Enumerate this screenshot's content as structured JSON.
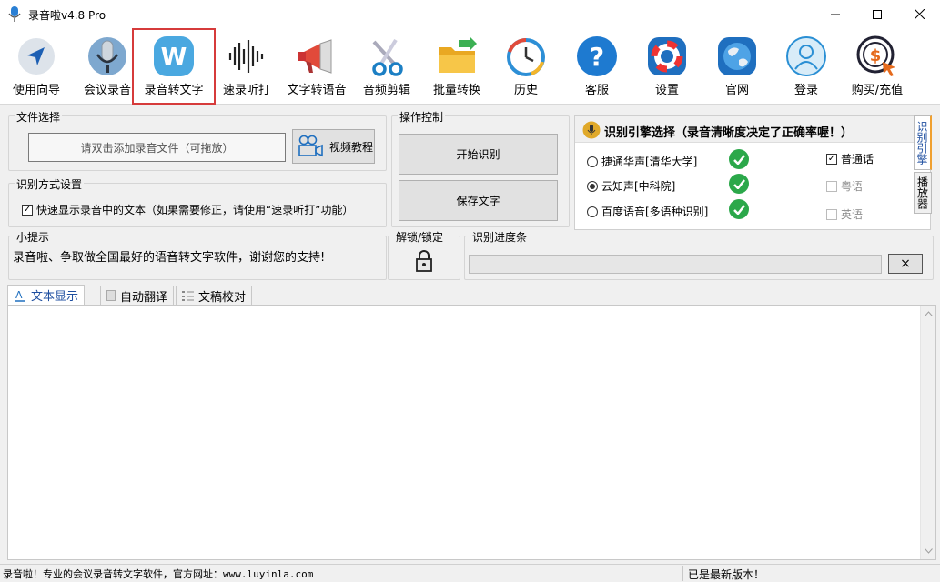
{
  "app": {
    "title": "录音啦v4.8 Pro"
  },
  "toolbar": {
    "items": [
      {
        "label": "使用向导",
        "icon": "cursor-arrow-icon"
      },
      {
        "label": "会议录音",
        "icon": "microphone-icon"
      },
      {
        "label": "录音转文字",
        "icon": "w-logo-icon"
      },
      {
        "label": "速录听打",
        "icon": "soundwave-icon"
      },
      {
        "label": "文字转语音",
        "icon": "megaphone-icon"
      },
      {
        "label": "音频剪辑",
        "icon": "scissors-icon"
      },
      {
        "label": "批量转换",
        "icon": "folder-icon"
      },
      {
        "label": "历史",
        "icon": "history-clock-icon"
      },
      {
        "label": "客服",
        "icon": "help-icon"
      },
      {
        "label": "设置",
        "icon": "lifebuoy-icon"
      },
      {
        "label": "官网",
        "icon": "globe-icon"
      },
      {
        "label": "登录",
        "icon": "user-icon"
      },
      {
        "label": "购买/充值",
        "icon": "dollar-cursor-icon"
      }
    ],
    "selected": "录音转文字"
  },
  "file_select": {
    "title": "文件选择",
    "add_button": "请双击添加录音文件（可拖放）",
    "video_button": "视频教程"
  },
  "recognize_mode": {
    "title": "识别方式设置",
    "option": "快速显示录音中的文本（如果需要修正，请使用“速录听打”功能）",
    "checked": true
  },
  "tip": {
    "title": "小提示",
    "text": "录音啦、争取做全国最好的语音转文字软件，谢谢您的支持!"
  },
  "operation": {
    "title": "操作控制",
    "start_button": "开始识别",
    "save_button": "保存文字"
  },
  "lock": {
    "title": "解锁/锁定"
  },
  "progress": {
    "title": "识别进度条",
    "value": 0,
    "cancel_symbol": "×"
  },
  "engine": {
    "title": "识别引擎选择（录音清晰度决定了正确率喔！）",
    "options": [
      {
        "label": "捷通华声[清华大学]",
        "selected": false
      },
      {
        "label": "云知声[中科院]",
        "selected": true
      },
      {
        "label": "百度语音[多语种识别]",
        "selected": false
      }
    ],
    "languages": [
      {
        "label": "普通话",
        "checked": true,
        "enabled": true
      },
      {
        "label": "粤语",
        "checked": false,
        "enabled": false
      },
      {
        "label": "英语",
        "checked": false,
        "enabled": false
      }
    ],
    "side_tabs": [
      "识别引擎",
      "播放器"
    ]
  },
  "tabs": [
    {
      "label": "文本显示",
      "active": true
    },
    {
      "label": "自动翻译",
      "active": false
    },
    {
      "label": "文稿校对",
      "active": false
    }
  ],
  "statusbar": {
    "left": "录音啦！专业的会议录音转文字软件，官方网址：www.luyinla.com",
    "right": "已是最新版本！"
  },
  "colors": {
    "accent": "#0066cc",
    "selected_outline": "#d63b3b",
    "check_green": "#2ba84a"
  }
}
